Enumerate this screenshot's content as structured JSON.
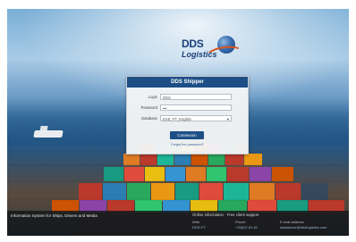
{
  "brand": {
    "line1": "DDS",
    "line2": "Logistics"
  },
  "login": {
    "title": "DDS Shipper",
    "login_label": "Login",
    "login_value": "DDS",
    "password_label": "Password",
    "password_value": "•••",
    "database_label": "Database",
    "database_value": "EXE_FT_English",
    "connect_label": "Connexion",
    "forgot_label": "Forgot the password?"
  },
  "footer": {
    "tagline": "Information System for Ships, Drivers and Media",
    "support": "Online information · Free client support",
    "col1_head": "Web",
    "col1_val": "DDS-FT",
    "col2_head": "Phone",
    "col2_val": "+33(0)7.61.61",
    "col3_head": "E-mail address",
    "col3_val": "assistance@ddslogistics.com"
  },
  "colors": {
    "header": "#1d4f86",
    "brand": "#1d3f7a",
    "swoosh": "#d9531e"
  }
}
